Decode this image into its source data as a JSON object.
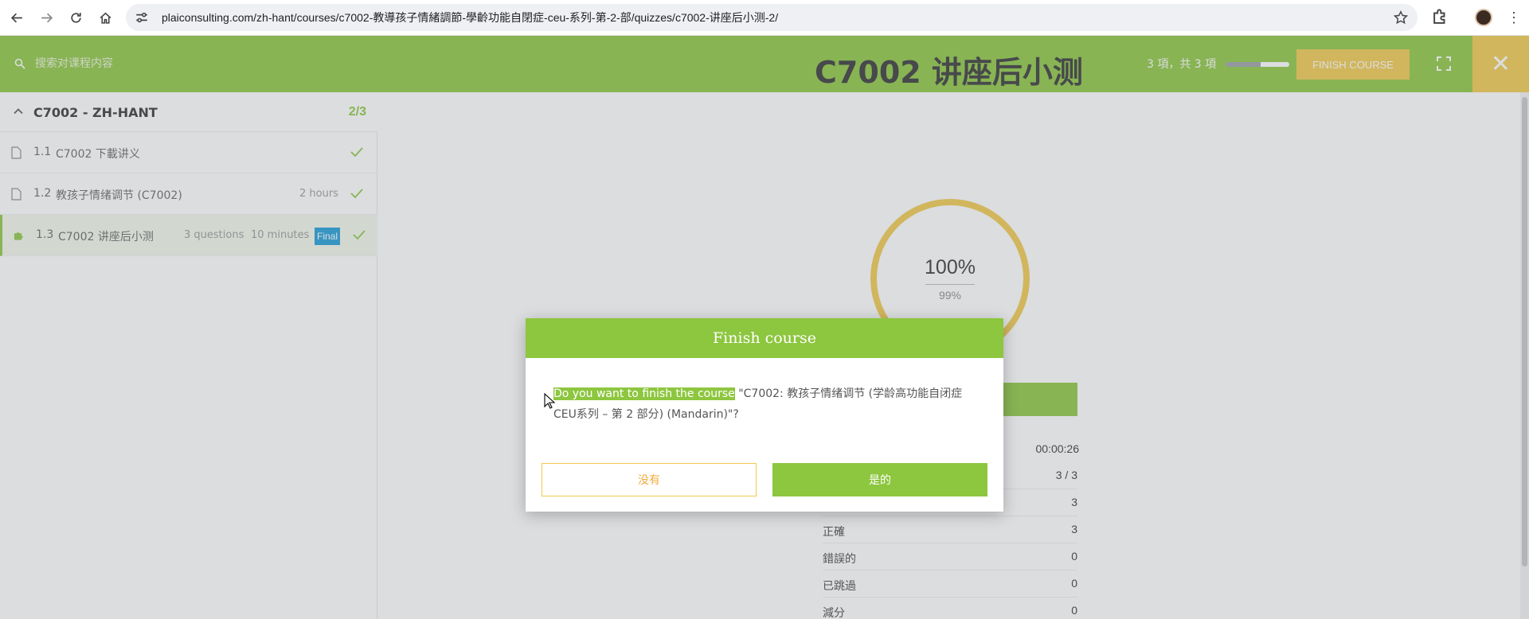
{
  "browser": {
    "url": "plaiconsulting.com/zh-hant/courses/c7002-教導孩子情緒調節-學齡功能自閉症-ceu-系列-第-2-部/quizzes/c7002-讲座后小测-2/"
  },
  "header": {
    "search_placeholder": "搜索对课程内容",
    "progress_text": "3 項，共 3 項",
    "progress_fraction": 1.0,
    "finish_label": "FINISH COURSE",
    "close_icon": "✕"
  },
  "sidebar": {
    "section_title": "C7002 - ZH-HANT",
    "section_count": "2/3",
    "lessons": [
      {
        "number": "1.1",
        "title": "C7002 下載讲义",
        "meta": "",
        "completed": true
      },
      {
        "number": "1.2",
        "title": "教孩子情绪调节 (C7002)",
        "meta": "2 hours",
        "completed": true
      },
      {
        "number": "1.3",
        "title": "C7002 讲座后小测",
        "questions": "3 questions",
        "duration": "10 minutes",
        "badge": "Final",
        "completed": true
      }
    ]
  },
  "quiz": {
    "title": "C7002 讲座后小测",
    "score": "100%",
    "passing": "99%",
    "time": "00:00:26",
    "stats": [
      {
        "label": "",
        "value": "3 / 3"
      },
      {
        "label": "",
        "value": "3"
      },
      {
        "label": "正確",
        "value": "3"
      },
      {
        "label": "錯誤的",
        "value": "0"
      },
      {
        "label": "已跳過",
        "value": "0"
      },
      {
        "label": "減分",
        "value": "0"
      }
    ]
  },
  "modal": {
    "title": "Finish course",
    "highlight": "Do you want to finish the course",
    "message_rest": " \"C7002: 教孩子情绪调节 (学龄高功能自闭症 CEU系列 – 第 2 部分) (Mandarin)\"?",
    "no_label": "没有",
    "yes_label": "是的"
  },
  "colors": {
    "accent_green": "#8dc63f",
    "accent_yellow": "#f2c94c",
    "badge_blue": "#1e9bd7"
  }
}
